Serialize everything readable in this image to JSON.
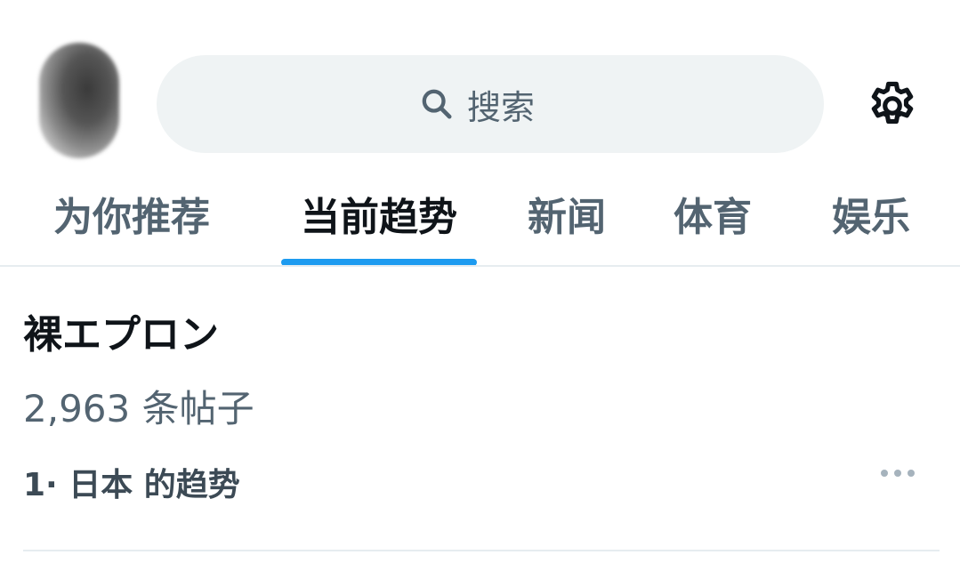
{
  "header": {
    "search_label": "搜索",
    "avatar": "avatar",
    "settings_icon": "gear-icon",
    "search_icon": "search-icon"
  },
  "tabs": [
    {
      "label": "为你推荐",
      "active": false
    },
    {
      "label": "当前趋势",
      "active": true
    },
    {
      "label": "新闻",
      "active": false
    },
    {
      "label": "体育",
      "active": false
    },
    {
      "label": "娱乐",
      "active": false
    }
  ],
  "trend": {
    "title": "裸エプロン",
    "post_count": "2,963 条帖子",
    "context": "1· 日本 的趋势",
    "more_icon": "more-icon"
  },
  "colors": {
    "accent": "#1d9bf0",
    "text_primary": "#0f1419",
    "text_secondary": "#536471",
    "search_bg": "#eff3f4"
  }
}
